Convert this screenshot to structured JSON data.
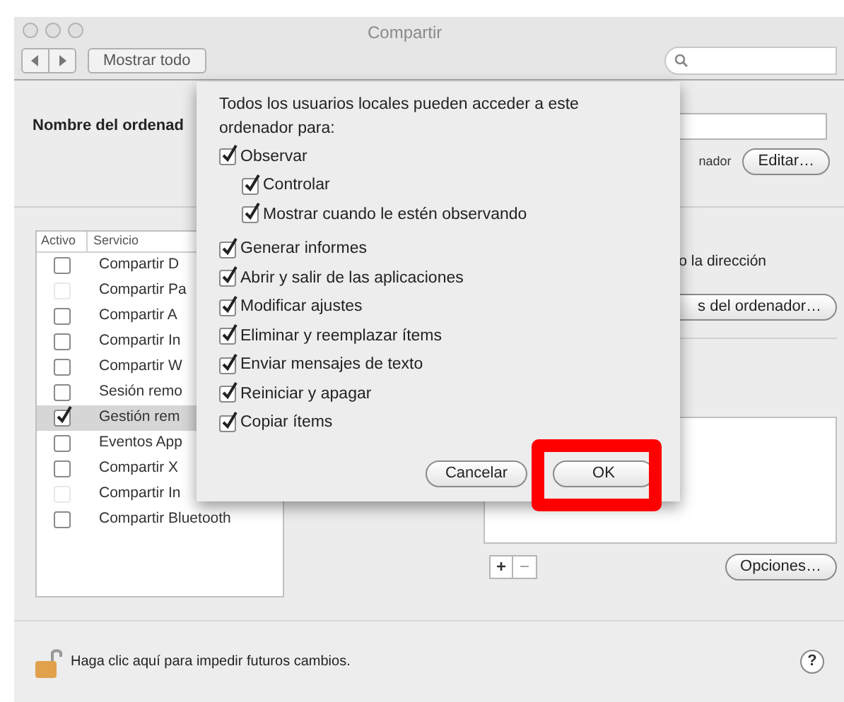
{
  "window": {
    "title": "Compartir"
  },
  "toolbar": {
    "show_all_button": "Mostrar todo"
  },
  "computer_name": {
    "label": "Nombre del ordenad",
    "note": "nador",
    "edit_button": "Editar…"
  },
  "services": {
    "columns": [
      "Activo",
      "Servicio"
    ],
    "rows": [
      {
        "name": "Compartir D",
        "checked": false,
        "disabled": false,
        "selected": false
      },
      {
        "name": "Compartir Pa",
        "checked": false,
        "disabled": true,
        "selected": false
      },
      {
        "name": "Compartir A",
        "checked": false,
        "disabled": false,
        "selected": false
      },
      {
        "name": "Compartir In",
        "checked": false,
        "disabled": false,
        "selected": false
      },
      {
        "name": "Compartir W",
        "checked": false,
        "disabled": false,
        "selected": false
      },
      {
        "name": "Sesión remo",
        "checked": false,
        "disabled": false,
        "selected": false
      },
      {
        "name": "Gestión rem",
        "checked": true,
        "disabled": false,
        "selected": true
      },
      {
        "name": "Eventos App",
        "checked": false,
        "disabled": false,
        "selected": false
      },
      {
        "name": "Compartir X",
        "checked": false,
        "disabled": false,
        "selected": false
      },
      {
        "name": "Compartir In",
        "checked": false,
        "disabled": true,
        "selected": false
      },
      {
        "name": "Compartir Bluetooth",
        "checked": false,
        "disabled": false,
        "selected": false
      }
    ]
  },
  "service_detail": {
    "text": "o la dirección",
    "settings_button": "s del ordenador…",
    "add_button": "+",
    "remove_button": "−",
    "options_button": "Opciones…"
  },
  "footer": {
    "lock_text": "Haga clic aquí para impedir futuros cambios.",
    "help": "?"
  },
  "sheet": {
    "intro": "Todos los usuarios locales pueden acceder a este ordenador para:",
    "options": [
      {
        "label": "Observar",
        "checked": true,
        "children": [
          {
            "label": "Controlar",
            "checked": true
          },
          {
            "label": "Mostrar cuando le estén observando",
            "checked": true
          }
        ]
      },
      {
        "label": "Generar informes",
        "checked": true
      },
      {
        "label": "Abrir y salir de las aplicaciones",
        "checked": true
      },
      {
        "label": "Modificar ajustes",
        "checked": true
      },
      {
        "label": "Eliminar y reemplazar ítems",
        "checked": true
      },
      {
        "label": "Enviar mensajes de texto",
        "checked": true
      },
      {
        "label": "Reiniciar y apagar",
        "checked": true
      },
      {
        "label": "Copiar ítems",
        "checked": true
      }
    ],
    "buttons": [
      {
        "label": "Cancelar",
        "highlighted": false
      },
      {
        "label": "OK",
        "highlighted": true
      }
    ]
  }
}
